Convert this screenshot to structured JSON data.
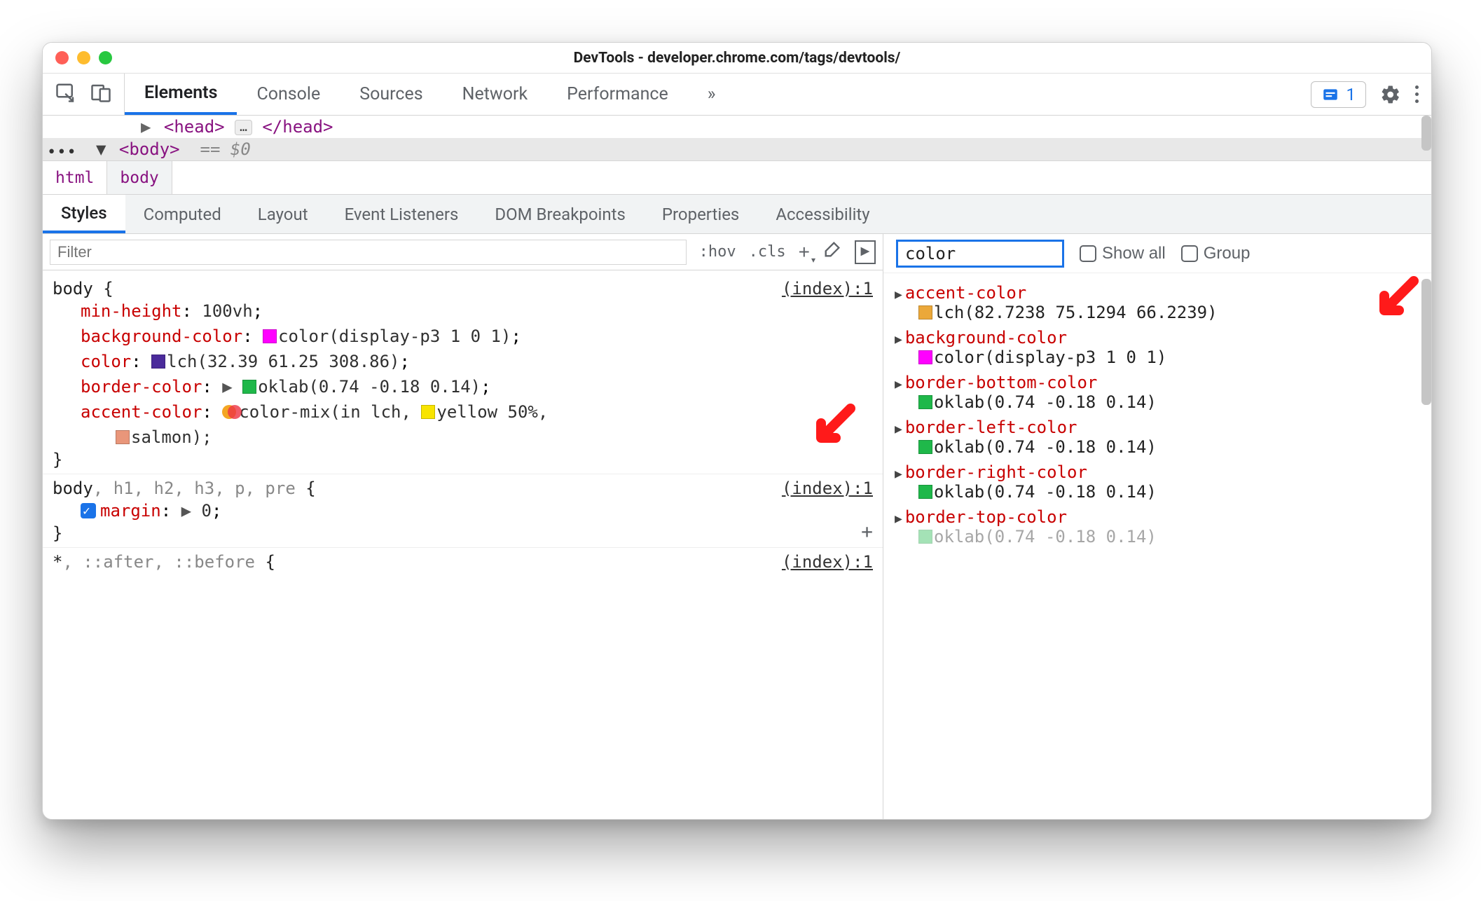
{
  "window": {
    "title": "DevTools - developer.chrome.com/tags/devtools/"
  },
  "tabs": {
    "items": [
      "Elements",
      "Console",
      "Sources",
      "Network",
      "Performance"
    ],
    "overflow": "»",
    "issues_count": "1"
  },
  "dom": {
    "head_open": "<head>",
    "head_close": "</head>",
    "ellipsis": "…",
    "body_open": "<body>",
    "eq": "== $0"
  },
  "breadcrumb": {
    "items": [
      "html",
      "body"
    ]
  },
  "subtabs": {
    "items": [
      "Styles",
      "Computed",
      "Layout",
      "Event Listeners",
      "DOM Breakpoints",
      "Properties",
      "Accessibility"
    ]
  },
  "styles_toolbar": {
    "filter_placeholder": "Filter",
    "hov": ":hov",
    "cls": ".cls"
  },
  "rules": [
    {
      "selector_html": "body",
      "source": "(index):1",
      "open": "{",
      "close": "}",
      "decls": [
        {
          "prop": "min-height",
          "val": "100vh",
          "swatch": null
        },
        {
          "prop": "background-color",
          "val": "color(display-p3 1 0 1)",
          "swatch": "#ff00ff"
        },
        {
          "prop": "color",
          "val": "lch(32.39 61.25 308.86)",
          "swatch": "#4b2b9b"
        },
        {
          "prop": "border-color",
          "arrow": true,
          "val": "oklab(0.74 -0.18 0.14)",
          "swatch": "#1fb84a"
        },
        {
          "prop": "accent-color",
          "mix": true,
          "val_prefix": "color-mix(in lch, ",
          "val_y_swatch": "#f8e400",
          "val_y": "yellow 50%,",
          "cont_swatch": "#e9967a",
          "cont": "salmon);"
        }
      ]
    },
    {
      "selector_html": "body, h1, h2, h3, p, pre",
      "source": "(index):1",
      "open": "{",
      "close": "}",
      "decls": [
        {
          "checkbox": true,
          "prop": "margin",
          "arrow": true,
          "val": "0"
        }
      ],
      "show_plus": true
    },
    {
      "selector_html": "*, ::after, ::before",
      "source": "(index):1",
      "open": "{",
      "cut": true
    }
  ],
  "computed": {
    "filter_value": "color",
    "show_all": "Show all",
    "group": "Group",
    "items": [
      {
        "prop": "accent-color",
        "swatch": "#eba83a",
        "val": "lch(82.7238 75.1294 66.2239)"
      },
      {
        "prop": "background-color",
        "swatch": "#ff00ff",
        "val": "color(display-p3 1 0 1)"
      },
      {
        "prop": "border-bottom-color",
        "swatch": "#1fb84a",
        "val": "oklab(0.74 -0.18 0.14)"
      },
      {
        "prop": "border-left-color",
        "swatch": "#1fb84a",
        "val": "oklab(0.74 -0.18 0.14)"
      },
      {
        "prop": "border-right-color",
        "swatch": "#1fb84a",
        "val": "oklab(0.74 -0.18 0.14)"
      },
      {
        "prop": "border-top-color",
        "swatch": "#1fb84a",
        "val": "oklab(0.74 -0.18 0.14)",
        "cut": true
      }
    ]
  }
}
